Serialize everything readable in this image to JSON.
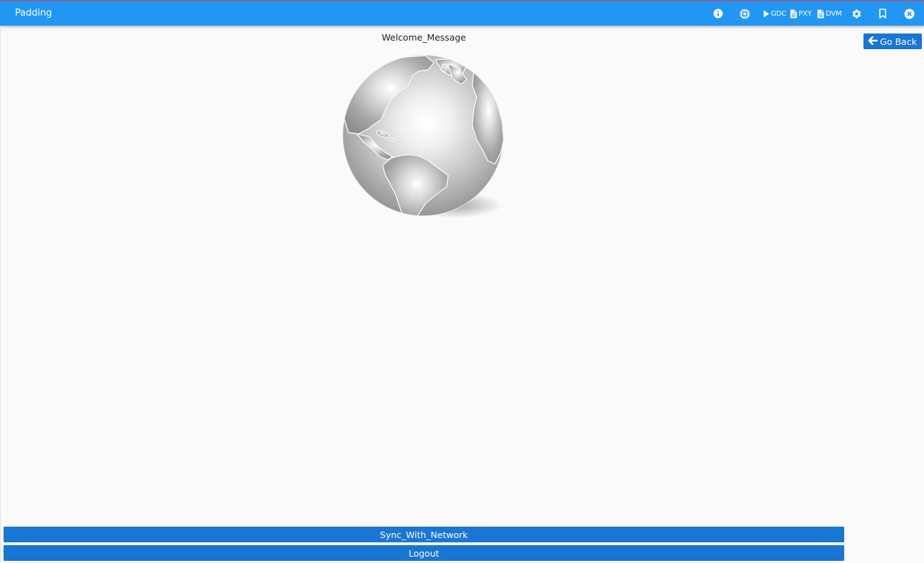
{
  "header": {
    "title": "Padding",
    "actions": [
      {
        "icon": "info-icon",
        "label": ""
      },
      {
        "icon": "chip-icon",
        "label": ""
      },
      {
        "icon": "play-icon",
        "label": "GDC"
      },
      {
        "icon": "file-icon",
        "label": "PXY"
      },
      {
        "icon": "file-icon",
        "label": "DVM"
      },
      {
        "icon": "gear-icon",
        "label": ""
      },
      {
        "icon": "bookmark-icon",
        "label": ""
      },
      {
        "icon": "close-circle-icon",
        "label": ""
      }
    ]
  },
  "main": {
    "welcome_text": "Welcome_Message",
    "globe_icon": "globe-icon",
    "go_back_label": "Go Back",
    "go_back_icon": "arrow-left-icon"
  },
  "footer": {
    "sync_label": "Sync_With_Network",
    "logout_label": "Logout"
  },
  "colors": {
    "header_bg": "#2196f3",
    "button_bg": "#1976d2",
    "page_bg": "#fafafa",
    "header_top_border": "#e53935"
  }
}
